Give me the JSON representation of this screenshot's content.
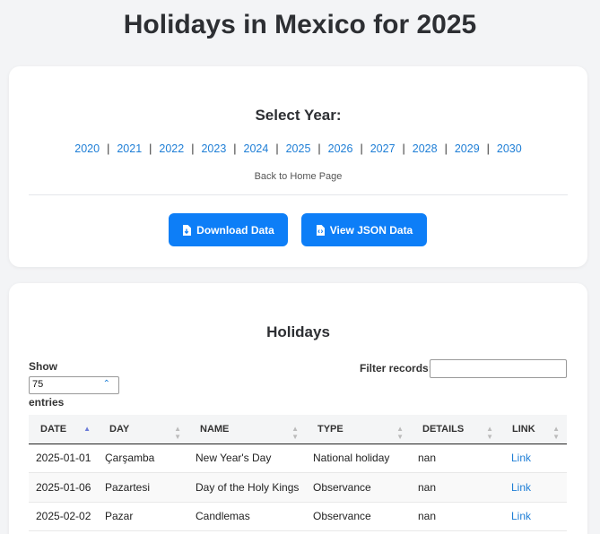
{
  "page": {
    "title": "Holidays in Mexico for 2025"
  },
  "year_selector": {
    "heading": "Select Year:",
    "years": [
      "2020",
      "2021",
      "2022",
      "2023",
      "2024",
      "2025",
      "2026",
      "2027",
      "2028",
      "2029",
      "2030"
    ],
    "separator": "|",
    "home_link": "Back to Home Page"
  },
  "actions": {
    "download_label": "Download Data",
    "json_label": "View JSON Data",
    "icons": [
      "file-download-icon",
      "file-json-icon"
    ],
    "accent_color": "#0d7ef7"
  },
  "holidays": {
    "heading": "Holidays",
    "show_label": "Show",
    "entries_value": "75",
    "entries_label": "entries",
    "filter_label": "Filter records:",
    "filter_value": "",
    "columns": [
      "DATE",
      "DAY",
      "NAME",
      "TYPE",
      "DETAILS",
      "LINK"
    ],
    "sorted_column": "DATE",
    "rows": [
      {
        "date": "2025-01-01",
        "day": "Çarşamba",
        "name": "New Year's Day",
        "type": "National holiday",
        "details": "nan",
        "link": "Link"
      },
      {
        "date": "2025-01-06",
        "day": "Pazartesi",
        "name": "Day of the Holy Kings",
        "type": "Observance",
        "details": "nan",
        "link": "Link"
      },
      {
        "date": "2025-02-02",
        "day": "Pazar",
        "name": "Candlemas",
        "type": "Observance",
        "details": "nan",
        "link": "Link"
      }
    ]
  }
}
